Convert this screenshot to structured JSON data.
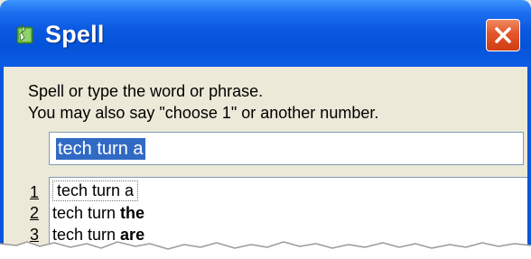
{
  "window": {
    "title": "Spell",
    "app_icon": "speech-app-icon",
    "close_icon": "close-icon"
  },
  "instructions": {
    "line1": "Spell or type the word or phrase.",
    "line2": "You may also say \"choose 1\" or another number."
  },
  "input": {
    "value": "tech turn a"
  },
  "suggestions": [
    {
      "number": "1",
      "prefix": "tech turn a",
      "bold": ""
    },
    {
      "number": "2",
      "prefix": "tech turn ",
      "bold": "the"
    },
    {
      "number": "3",
      "prefix": "tech turn ",
      "bold": "are"
    }
  ],
  "colors": {
    "titlebar": "#0553d8",
    "close_button": "#e2562c",
    "selection": "#316ac5",
    "dialog_bg": "#ece9d8"
  }
}
